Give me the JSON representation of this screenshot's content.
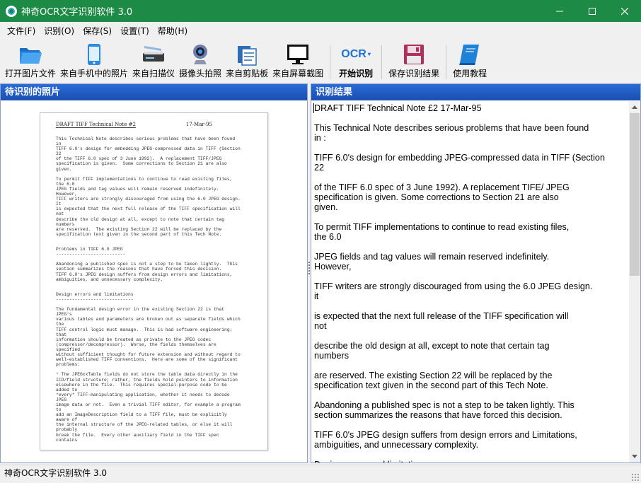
{
  "window": {
    "title": "神奇OCR文字识别软件 3.0",
    "accent": "#1d8a45",
    "controls": [
      "minimize-icon",
      "maximize-icon",
      "close-icon"
    ]
  },
  "menu": [
    "文件(F)",
    "识别(O)",
    "保存(S)",
    "设置(T)",
    "帮助(H)"
  ],
  "toolbar": [
    {
      "label": "打开图片文件",
      "icon": "folder-open-icon"
    },
    {
      "label": "来自手机中的照片",
      "icon": "phone-icon"
    },
    {
      "label": "来自扫描仪",
      "icon": "scanner-icon"
    },
    {
      "label": "摄像头拍照",
      "icon": "webcam-icon"
    },
    {
      "label": "来自剪贴板",
      "icon": "clipboard-icon"
    },
    {
      "label": "来自屏幕截图",
      "icon": "monitor-icon"
    },
    {
      "label": "开始识别",
      "icon": "ocr-icon",
      "icon_text": "OCR"
    },
    {
      "label": "保存识别结果",
      "icon": "save-disk-icon"
    },
    {
      "label": "使用教程",
      "icon": "book-icon"
    }
  ],
  "left_panel": {
    "title": "待识别的照片",
    "scan": {
      "header_left": "DRAFT TIFF Technical Note #2",
      "header_right": "17-Mar-95",
      "body": "This Technical Note describes serious problems that have been found\nin\nTIFF 6.0's design for embedding JPEG-compressed data in TIFF (Section\n22\nof the TIFF 6.0 spec of 3 June 1992).  A replacement TIFF/JPEG\nspecification is given.  Some corrections to Section 21 are also\ngiven.\n\nTo permit TIFF implementations to continue to read existing files,\nthe 6.0\nJPEG fields and tag values will remain reserved indefinitely.\nHowever,\nTIFF writers are strongly discouraged from using the 6.0 JPEG design.\nIt\nis expected that the next full release of the TIFF specification will\nnot\ndescribe the old design at all, except to note that certain tag\nnumbers\nare reserved.  The existing Section 22 will be replaced by the\nspecification text given in the second part of this Tech Note.\n\n\nProblems in TIFF 6.0 JPEG\n--------------------------\n\nAbandoning a published spec is not a step to be taken lightly.  This\nsection summarizes the reasons that have forced this decision.\nTIFF 6.0's JPEG design suffers from design errors and limitations,\nambiguities, and unnecessary complexity.\n\n\nDesign errors and limitations\n-----------------------------\n\nThe fundamental design error in the existing Section 22 is that\nJPEG's\nvarious tables and parameters are broken out as separate fields which\nthe\nTIFF control logic must manage.  This is bad software engineering:\nthat\ninformation should be treated as private to the JPEG codec\n(compressor/decompressor).  Worse, the fields themselves are\nspecified\nwithout sufficient thought for future extension and without regard to\nwell-established TIFF conventions.  Here are some of the significant\nproblems:\n\n* The JPEGxxTable fields do not store the table data directly in the\nIFD/field structure; rather, the fields hold pointers to information\nelsewhere in the file.  This requires special-purpose code to be\nadded to\n*every* TIFF-manipulating application, whether it needs to decode\nJPEG\nimage data or not.  Even a trivial TIFF editor, for example a program\nto\nadd an ImageDescription field to a TIFF file, must be explicitly\naware of\nthe internal structure of the JPEG-related tables, or else it will\nprobably\nbreak the file.  Every other auxiliary field in the TIFF spec\ncontains"
    }
  },
  "right_panel": {
    "title": "识别结果",
    "lines": [
      "DRAFT TIFF Technical Note £2 17-Mar-95",
      "",
      "This Technical Note describes serious problems that have been found",
      "in :",
      "",
      "TIFF 6.0's design for embedding JPEG-compressed data in TIFF (Section",
      "22",
      "",
      "of the TIFF 6.0 spec of 3 June 1992). A replacement TIFE/ JPEG",
      "specification is given. Some corrections to Section 21 are also",
      "given.",
      "",
      "To permit TIFF implementations to continue to read existing files,",
      "the 6.0",
      "",
      "JPEG fields and tag values will remain reserved indefinitely.",
      "However,",
      "",
      "TIFF writers are strongly discouraged from using the 6.0 JPEG design.",
      "it",
      "",
      "is expected that the next full release of the TIFF specification will",
      "not",
      "",
      "describe the old design at all, except to note that certain tag",
      "numbers",
      "",
      "are reserved. The existing Section 22 will be replaced by the",
      "specification text given in the second part of this Tech Note.",
      "",
      "Abandoning a published spec is not a step to be taken lightly. This",
      "section summarizes the reasons that have forced this decision.",
      "",
      "TIFF 6.0's JPEG design suffers from design errors and Limitations,",
      "ambiguities, and unnecessary complexity.",
      "",
      "Design errors and limitations"
    ]
  },
  "status": {
    "text": "神奇OCR文字识别软件 3.0"
  }
}
